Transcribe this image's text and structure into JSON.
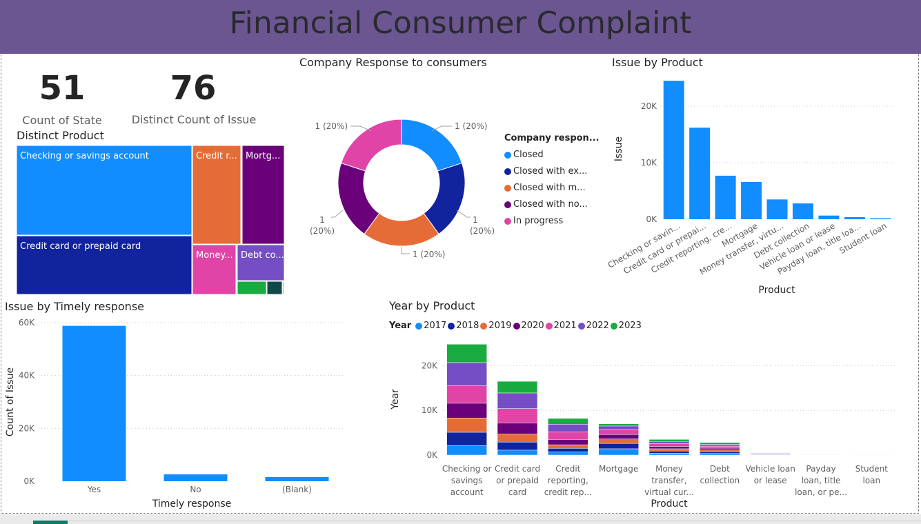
{
  "title": "Financial Consumer Complaint",
  "cards": [
    {
      "value": "51",
      "label": "Count of State"
    },
    {
      "value": "76",
      "label": "Distinct Count of Issue"
    }
  ],
  "colors": {
    "header": "#6b5691",
    "c2017": "#118dff",
    "c2018": "#12239e",
    "c2019": "#e66c37",
    "c2020": "#6b007b",
    "c2021": "#e044a7",
    "c2022": "#744ec2",
    "c2023": "#1aab40"
  },
  "chart_data": [
    {
      "id": "treemap",
      "type": "treemap",
      "title": "Distinct Product",
      "items": [
        {
          "label": "Checking or savings account",
          "color": "#118dff"
        },
        {
          "label": "Credit card or prepaid card",
          "color": "#12239e"
        },
        {
          "label": "Credit r...",
          "color": "#e66c37"
        },
        {
          "label": "Mortg...",
          "color": "#6b007b"
        },
        {
          "label": "Money...",
          "color": "#e044a7"
        },
        {
          "label": "Debt co...",
          "color": "#744ec2"
        },
        {
          "label": "",
          "color": "#1aab40"
        },
        {
          "label": "",
          "color": "#0e4a4a"
        },
        {
          "label": "",
          "color": "#d9b300"
        }
      ]
    },
    {
      "id": "donut",
      "type": "pie",
      "title": "Company Response to consumers",
      "legend_title": "Company respon...",
      "labels": [
        "Closed",
        "Closed with ex...",
        "Closed with m...",
        "Closed with no...",
        "In progress"
      ],
      "values": [
        1,
        1,
        1,
        1,
        1
      ],
      "value_labels": [
        "1 (20%)",
        "1 (20%)",
        "1 (20%)",
        "1 (20%)",
        "1 (20%)"
      ],
      "colors": [
        "#118dff",
        "#12239e",
        "#e66c37",
        "#6b007b",
        "#e044a7"
      ]
    },
    {
      "id": "issue_by_product",
      "type": "bar",
      "title": "Issue by Product",
      "xlabel": "Product",
      "ylabel": "Issue",
      "categories": [
        "Checking or savin...",
        "Credit card or prepai...",
        "Credit reporting, cre...",
        "Mortgage",
        "Money transfer, virtu...",
        "Debt collection",
        "Vehicle loan or lease",
        "Payday loan, title loa...",
        "Student loan"
      ],
      "values": [
        24500,
        16200,
        7700,
        6600,
        3500,
        2800,
        650,
        380,
        180
      ],
      "yticks": [
        0,
        10000,
        20000
      ],
      "ytick_labels": [
        "0K",
        "10K",
        "20K"
      ],
      "ylim": [
        0,
        25000
      ],
      "color": "#118dff"
    },
    {
      "id": "timely",
      "type": "bar",
      "title": "Issue by Timely response",
      "xlabel": "Timely response",
      "ylabel": "Count of Issue",
      "categories": [
        "Yes",
        "No",
        "(Blank)"
      ],
      "values": [
        58800,
        2600,
        1600
      ],
      "yticks": [
        0,
        20000,
        40000,
        60000
      ],
      "ytick_labels": [
        "0K",
        "20K",
        "40K",
        "60K"
      ],
      "ylim": [
        0,
        60000
      ],
      "color": "#118dff"
    },
    {
      "id": "year_by_product",
      "type": "bar",
      "stacked": true,
      "title": "Year by Product",
      "xlabel": "Product",
      "ylabel": "Year",
      "legend_title": "Year",
      "categories": [
        [
          "Checking or",
          "savings",
          "account"
        ],
        [
          "Credit card",
          "or prepaid",
          "card"
        ],
        [
          "Credit",
          "reporting,",
          "credit rep..."
        ],
        [
          "Mortgage"
        ],
        [
          "Money",
          "transfer,",
          "virtual cur..."
        ],
        [
          "Debt",
          "collection"
        ],
        [
          "Vehicle loan",
          "or lease"
        ],
        [
          "Payday",
          "loan, title",
          "loan, or pe..."
        ],
        [
          "Student",
          "loan"
        ]
      ],
      "series": [
        {
          "name": "2017",
          "color": "#118dff",
          "values": [
            2100,
            1100,
            700,
            1400,
            400,
            350,
            100,
            60,
            30
          ]
        },
        {
          "name": "2018",
          "color": "#12239e",
          "values": [
            3000,
            1800,
            800,
            1200,
            500,
            400,
            100,
            60,
            25
          ]
        },
        {
          "name": "2019",
          "color": "#e66c37",
          "values": [
            3200,
            1800,
            800,
            1000,
            500,
            400,
            100,
            60,
            25
          ]
        },
        {
          "name": "2020",
          "color": "#6b007b",
          "values": [
            3300,
            2500,
            1200,
            1000,
            550,
            400,
            100,
            50,
            25
          ]
        },
        {
          "name": "2021",
          "color": "#e044a7",
          "values": [
            3900,
            3200,
            1700,
            1100,
            600,
            450,
            100,
            50,
            25
          ]
        },
        {
          "name": "2022",
          "color": "#744ec2",
          "values": [
            5200,
            3500,
            1700,
            800,
            500,
            400,
            100,
            50,
            25
          ]
        },
        {
          "name": "2023",
          "color": "#1aab40",
          "values": [
            4100,
            2600,
            1300,
            500,
            450,
            400,
            50,
            50,
            25
          ]
        }
      ],
      "yticks": [
        0,
        10000,
        20000
      ],
      "ytick_labels": [
        "0K",
        "10K",
        "20K"
      ],
      "ylim": [
        0,
        25000
      ]
    }
  ]
}
